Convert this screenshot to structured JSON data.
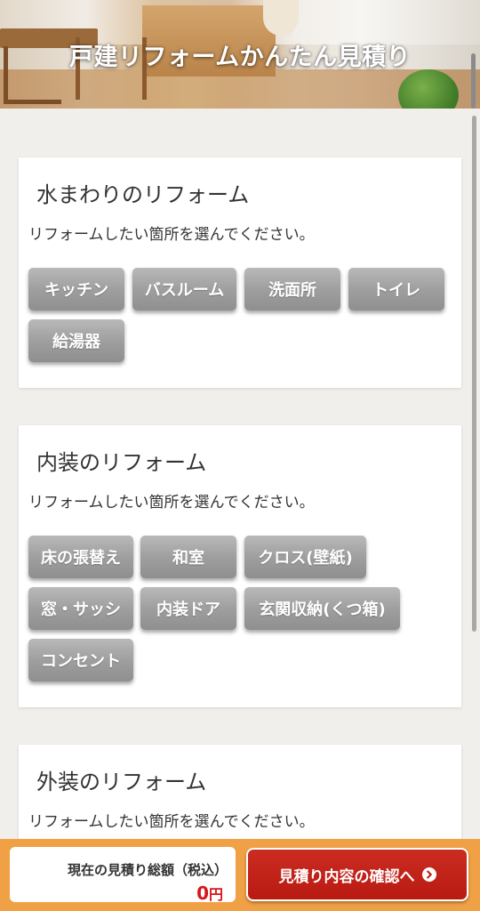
{
  "header": {
    "title": "戸建リフォームかんたん見積り"
  },
  "sections": [
    {
      "title": "水まわりのリフォーム",
      "description": "リフォームしたい箇所を選んでください。",
      "buttons": [
        "キッチン",
        "バスルーム",
        "洗面所",
        "トイレ",
        "給湯器"
      ]
    },
    {
      "title": "内装のリフォーム",
      "description": "リフォームしたい箇所を選んでください。",
      "buttons": [
        "床の張替え",
        "和室",
        "クロス(壁紙)",
        "窓・サッシ",
        "内装ドア",
        "玄関収納(くつ箱)",
        "コンセント"
      ]
    },
    {
      "title": "外装のリフォーム",
      "description": "リフォームしたい箇所を選んでください。"
    }
  ],
  "footer": {
    "total_label": "現在の見積り総額（税込）",
    "total_value": "0",
    "total_unit": "円",
    "confirm_label": "見積り内容の確認へ"
  },
  "colors": {
    "accent_orange": "#f0a045",
    "confirm_red": "#c42419",
    "price_red": "#d7161a",
    "button_gray": "#a3a3a3"
  }
}
